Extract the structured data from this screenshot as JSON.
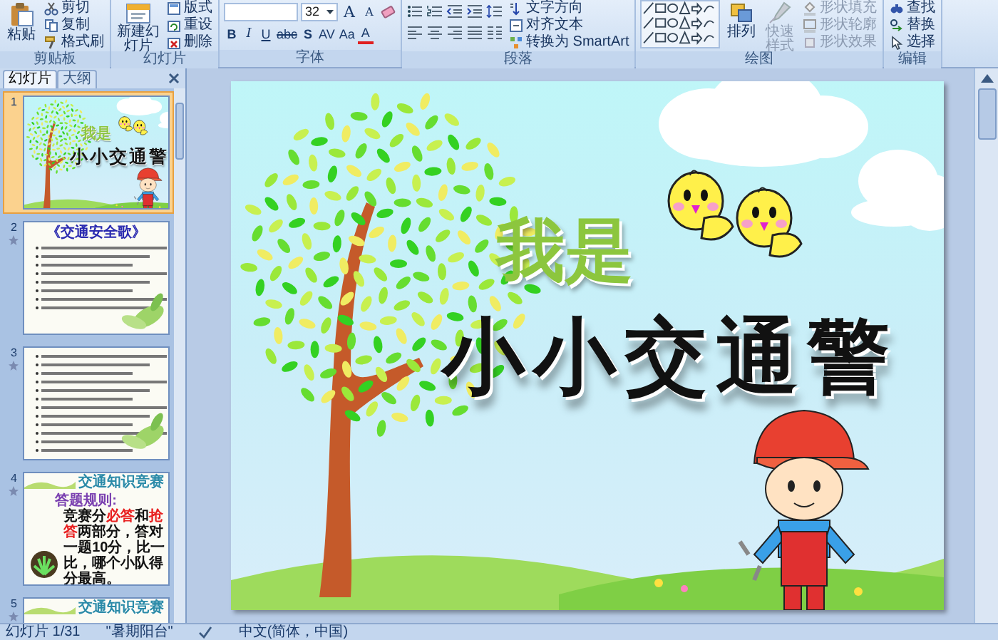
{
  "ribbon": {
    "groups": [
      {
        "kind": "clipboard",
        "label": "剪贴板",
        "large": {
          "label": "粘贴"
        },
        "small": [
          {
            "label": "剪切"
          },
          {
            "label": "复制"
          },
          {
            "label": "格式刷"
          }
        ]
      },
      {
        "kind": "slides",
        "label": "幻灯片",
        "large": {
          "label": "新建幻灯片"
        },
        "small": [
          {
            "label": "版式"
          },
          {
            "label": "重设"
          },
          {
            "label": "删除"
          }
        ]
      },
      {
        "kind": "font",
        "label": "字体",
        "font_size": "32",
        "size_buttons": [
          "A",
          "A"
        ],
        "format_buttons": [
          "B",
          "I",
          "U",
          "abc",
          "S",
          "AV",
          "Aa",
          "A"
        ]
      },
      {
        "kind": "paragraph",
        "label": "段落",
        "small": [
          {
            "label": "文字方向"
          },
          {
            "label": "对齐文本"
          },
          {
            "label": "转换为 SmartArt"
          }
        ]
      },
      {
        "kind": "drawing",
        "label": "绘图",
        "large": [
          {
            "label": "排列",
            "disabled": false
          },
          {
            "label": "快速样式",
            "disabled": true
          }
        ],
        "small": [
          {
            "label": "形状填充",
            "disabled": true
          },
          {
            "label": "形状轮廓",
            "disabled": true
          },
          {
            "label": "形状效果",
            "disabled": true
          }
        ]
      },
      {
        "kind": "editing",
        "label": "编辑",
        "small": [
          {
            "label": "查找"
          },
          {
            "label": "替换"
          },
          {
            "label": "选择"
          }
        ]
      }
    ]
  },
  "pane": {
    "tabs": [
      {
        "label": "幻灯片",
        "selected": true
      },
      {
        "label": "大纲",
        "selected": false
      }
    ],
    "thumbnails": [
      {
        "number": "1",
        "selected": true,
        "kind": "title",
        "subtitle": "我是",
        "title": "小小交通警"
      },
      {
        "number": "2",
        "selected": false,
        "kind": "song",
        "title": "《交通安全歌》"
      },
      {
        "number": "3",
        "selected": false,
        "kind": "lyrics"
      },
      {
        "number": "4",
        "selected": false,
        "kind": "rules",
        "header": "交通知识竞赛",
        "heading": "答题规则:",
        "rules": [
          {
            "text": "竞赛分",
            "highlight": false
          },
          {
            "text": "必答",
            "highlight": true
          },
          {
            "text": "和",
            "highlight": false
          },
          {
            "text": "抢答",
            "highlight": true
          },
          {
            "text": "两部分，答对一题10分，比一比，哪个小队得分最高。",
            "highlight": false
          }
        ]
      },
      {
        "number": "5",
        "selected": false,
        "kind": "header",
        "header": "交通知识竞赛"
      }
    ]
  },
  "slide": {
    "subtitle": "我是",
    "title": "小小交通警"
  },
  "status_bar": {
    "items": [
      "幻灯片 1/31",
      "\"暑期阳台\"",
      "中文(简体，中国)"
    ]
  }
}
